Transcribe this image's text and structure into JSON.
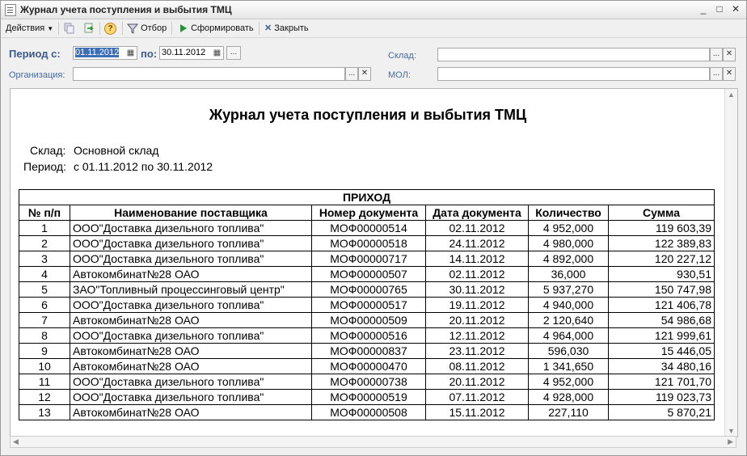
{
  "window": {
    "title": "Журнал учета поступления и выбытия ТМЦ",
    "minimize": "_",
    "maximize": "□",
    "close": "✕"
  },
  "toolbar": {
    "actions": "Действия",
    "filter": "Отбор",
    "generate": "Сформировать",
    "close": "Закрыть",
    "help": "?"
  },
  "form": {
    "period_from_label": "Период с:",
    "period_from": "01.11.2012",
    "period_to_label": "по:",
    "period_to": "30.11.2012",
    "ellipsis": "...",
    "warehouse_label": "Склад:",
    "warehouse_value": "",
    "organization_label": "Организация:",
    "organization_value": "",
    "mol_label": "МОЛ:",
    "mol_value": "",
    "clear": "✕"
  },
  "report": {
    "title": "Журнал учета поступления и выбытия ТМЦ",
    "warehouse_label": "Склад:",
    "warehouse_value": "Основной склад",
    "period_label": "Период:",
    "period_value": "с 01.11.2012 по 30.11.2012",
    "section_title": "ПРИХОД",
    "columns": [
      "№ п/п",
      "Наименование поставщика",
      "Номер документа",
      "Дата документа",
      "Количество",
      "Сумма"
    ],
    "rows": [
      [
        "1",
        "ООО\"Доставка дизельного топлива\"",
        "МОФ00000514",
        "02.11.2012",
        "4 952,000",
        "119 603,39"
      ],
      [
        "2",
        "ООО\"Доставка дизельного топлива\"",
        "МОФ00000518",
        "24.11.2012",
        "4 980,000",
        "122 389,83"
      ],
      [
        "3",
        "ООО\"Доставка дизельного топлива\"",
        "МОФ00000717",
        "14.11.2012",
        "4 892,000",
        "120 227,12"
      ],
      [
        "4",
        "Автокомбинат№28 ОАО",
        "МОФ00000507",
        "02.11.2012",
        "36,000",
        "930,51"
      ],
      [
        "5",
        "ЗАО\"Топливный процессинговый центр\"",
        "МОФ00000765",
        "30.11.2012",
        "5 937,270",
        "150 747,98"
      ],
      [
        "6",
        "ООО\"Доставка дизельного топлива\"",
        "МОФ00000517",
        "19.11.2012",
        "4 940,000",
        "121 406,78"
      ],
      [
        "7",
        "Автокомбинат№28 ОАО",
        "МОФ00000509",
        "20.11.2012",
        "2 120,640",
        "54 986,68"
      ],
      [
        "8",
        "ООО\"Доставка дизельного топлива\"",
        "МОФ00000516",
        "12.11.2012",
        "4 964,000",
        "121 999,61"
      ],
      [
        "9",
        "Автокомбинат№28 ОАО",
        "МОФ00000837",
        "23.11.2012",
        "596,030",
        "15 446,05"
      ],
      [
        "10",
        "Автокомбинат№28 ОАО",
        "МОФ00000470",
        "08.11.2012",
        "1 341,650",
        "34 480,16"
      ],
      [
        "11",
        "ООО\"Доставка дизельного топлива\"",
        "МОФ00000738",
        "20.11.2012",
        "4 952,000",
        "121 701,70"
      ],
      [
        "12",
        "ООО\"Доставка дизельного топлива\"",
        "МОФ00000519",
        "07.11.2012",
        "4 928,000",
        "119 023,73"
      ],
      [
        "13",
        "Автокомбинат№28 ОАО",
        "МОФ00000508",
        "15.11.2012",
        "227,110",
        "5 870,21"
      ]
    ]
  },
  "colors": {
    "label_blue": "#3c5a8a",
    "selection": "#3d6fb6",
    "generate_icon": "#1a9a2a"
  }
}
